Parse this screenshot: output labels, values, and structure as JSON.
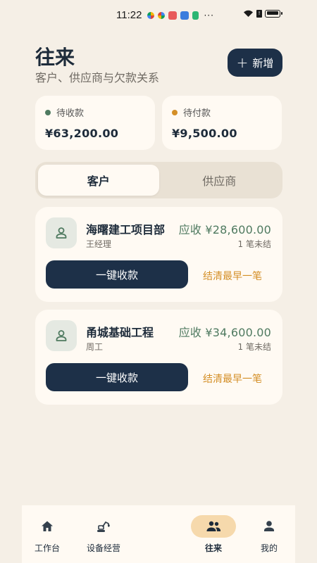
{
  "status_bar": {
    "time": "11:22",
    "more": "···"
  },
  "header": {
    "title": "往来",
    "subtitle": "客户、供应商与欠款关系",
    "add_label": "新增",
    "add_icon": "plus-icon"
  },
  "summary": {
    "receivable": {
      "label": "待收款",
      "amount": "¥63,200.00",
      "color": "#4f7a60"
    },
    "payable": {
      "label": "待付款",
      "amount": "¥9,500.00",
      "color": "#d48f27"
    }
  },
  "tabs": [
    {
      "label": "客户",
      "active": true
    },
    {
      "label": "供应商",
      "active": false
    }
  ],
  "customers": [
    {
      "name": "海曙建工项目部",
      "contact": "王经理",
      "due": "应收 ¥28,600.00",
      "open": "1 笔未结",
      "collect_label": "一键收款",
      "settle_label": "结清最早一笔",
      "avatar_icon": "person-icon"
    },
    {
      "name": "甬城基础工程",
      "contact": "周工",
      "due": "应收 ¥34,600.00",
      "open": "1 笔未结",
      "collect_label": "一键收款",
      "settle_label": "结清最早一笔",
      "avatar_icon": "person-icon"
    }
  ],
  "nav": [
    {
      "label": "工作台",
      "icon": "home-icon",
      "active": false
    },
    {
      "label": "设备经营",
      "icon": "excavator-icon",
      "active": false
    },
    {
      "label": "往来",
      "icon": "group-icon",
      "active": true
    },
    {
      "label": "我的",
      "icon": "person-icon",
      "active": false
    }
  ],
  "colors": {
    "background": "#f5efe6",
    "primary": "#1d3048",
    "accent_green": "#4f7a60",
    "accent_orange": "#d48f27",
    "nav_active": "#f6d9ac"
  }
}
